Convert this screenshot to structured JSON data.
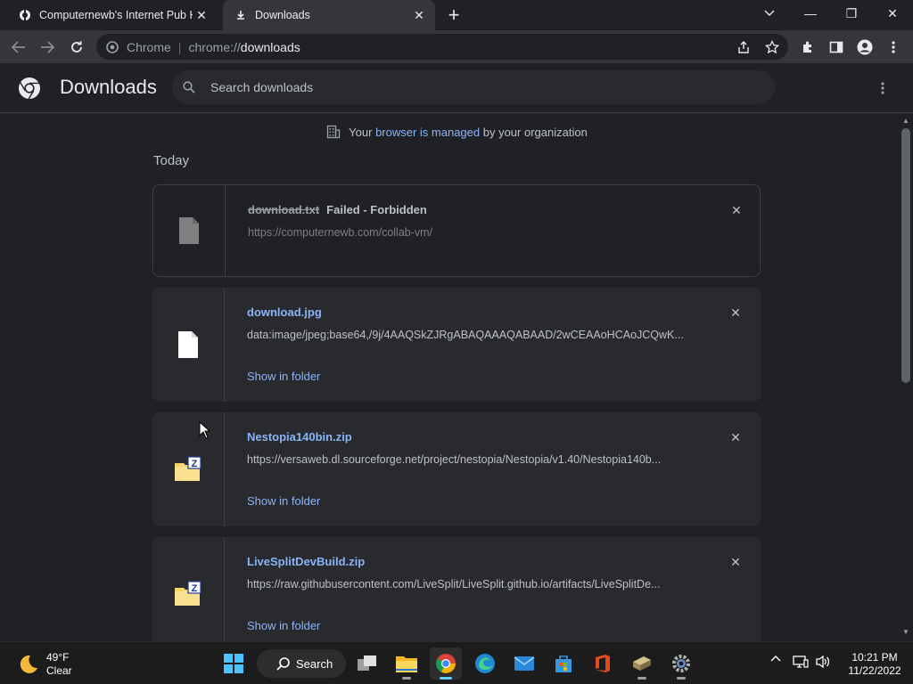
{
  "window": {
    "tabs": [
      {
        "title": "Computernewb's Internet Pub Hub",
        "active": false
      },
      {
        "title": "Downloads",
        "active": true
      }
    ],
    "new_tab": "+",
    "controls": {
      "minimize": "—",
      "restore": "❐",
      "close": "✕"
    }
  },
  "toolbar": {
    "site_chip": "Chrome",
    "url_scheme": "chrome://",
    "url_host": "downloads"
  },
  "header": {
    "title": "Downloads",
    "search_placeholder": "Search downloads"
  },
  "managed_notice": {
    "prefix": "Your ",
    "link": "browser is managed",
    "suffix": " by your organization"
  },
  "section_label": "Today",
  "downloads": [
    {
      "name": "download.txt",
      "status": "Failed - Forbidden",
      "url": "https://computernewb.com/collab-vm/",
      "action": "",
      "icon": "file-gray-icon",
      "failed": true
    },
    {
      "name": "download.jpg",
      "status": "",
      "url": "data:image/jpeg;base64,/9j/4AAQSkZJRgABAQAAAQABAAD/2wCEAAoHCAoJCQwK...",
      "action": "Show in folder",
      "icon": "file-white-icon",
      "failed": false
    },
    {
      "name": "Nestopia140bin.zip",
      "status": "",
      "url": "https://versaweb.dl.sourceforge.net/project/nestopia/Nestopia/v1.40/Nestopia140b...",
      "action": "Show in folder",
      "icon": "zip-folder-icon",
      "failed": false
    },
    {
      "name": "LiveSplitDevBuild.zip",
      "status": "",
      "url": "https://raw.githubusercontent.com/LiveSplit/LiveSplit.github.io/artifacts/LiveSplitDe...",
      "action": "Show in folder",
      "icon": "zip-folder-icon",
      "failed": false
    }
  ],
  "taskbar": {
    "weather_temp": "49°F",
    "weather_cond": "Clear",
    "search_label": "Search",
    "time": "10:21 PM",
    "date": "11/22/2022"
  },
  "colors": {
    "accent_link": "#8ab4f8",
    "background": "#202124",
    "card": "#292a2d"
  }
}
